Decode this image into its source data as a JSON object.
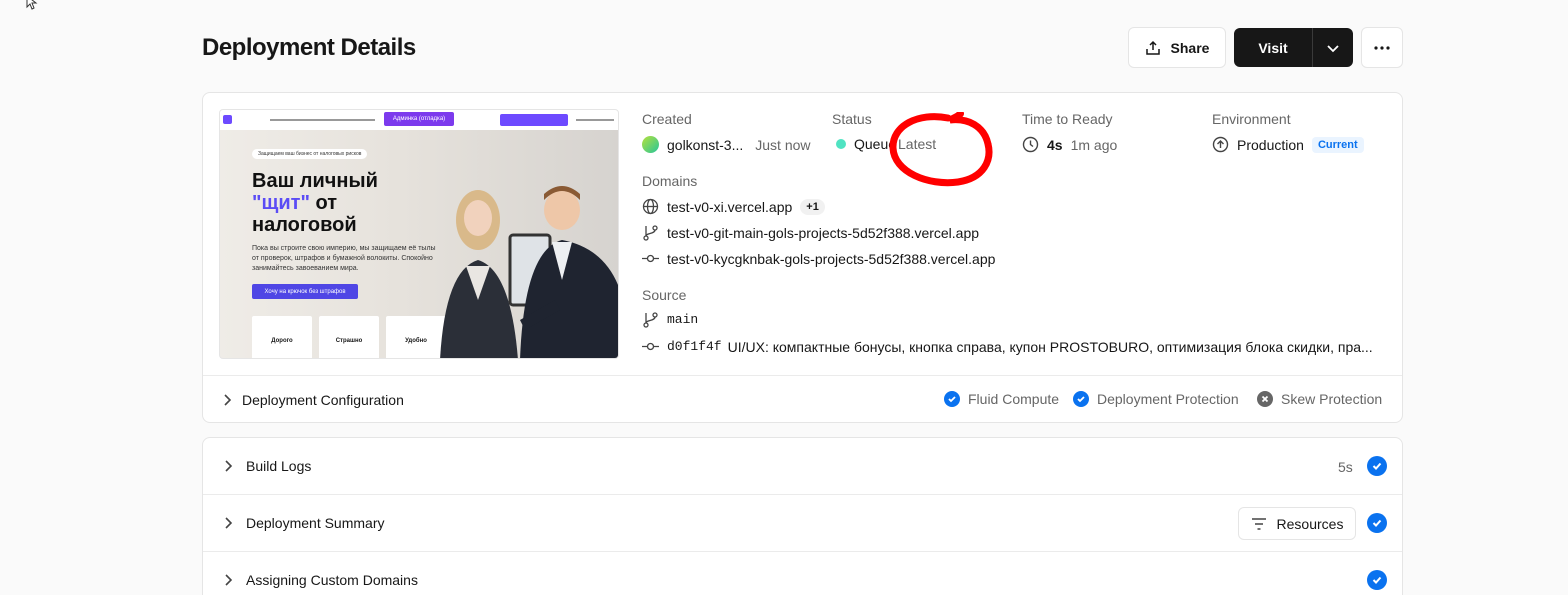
{
  "header": {
    "title": "Deployment Details",
    "share_label": "Share",
    "visit_label": "Visit"
  },
  "preview": {
    "nav_badge": "Админка (отладка)",
    "tagline": "Защищаем ваш бизнес от налоговых рисков",
    "headline_1": "Ваш личный",
    "headline_2": "\"щит\"",
    "headline_2b": " от",
    "headline_3": "налоговой",
    "body": "Пока вы строите свою империю, мы защищаем её тылы от проверок, штрафов и бумажной волокиты. Спокойно занимайтесь завоеванием мира.",
    "cta": "Хочу на крючок без штрафов",
    "tiles": [
      "Дорого",
      "Страшно",
      "Удобно"
    ]
  },
  "info": {
    "created_label": "Created",
    "created_user": "golkonst-3...",
    "created_time": "Just now",
    "status_label": "Status",
    "status_value": "Queued",
    "status_tag": "Latest",
    "ready_label": "Time to Ready",
    "ready_value": "4s",
    "ready_ago": "1m ago",
    "env_label": "Environment",
    "env_value": "Production",
    "env_badge": "Current",
    "domains_label": "Domains",
    "domains": [
      "test-v0-xi.vercel.app",
      "test-v0-git-main-gols-projects-5d52f388.vercel.app",
      "test-v0-kycgknbak-gols-projects-5d52f388.vercel.app"
    ],
    "domains_extra": "+1",
    "source_label": "Source",
    "branch": "main",
    "commit_hash": "d0f1f4f",
    "commit_message": "UI/UX: компактные бонусы, кнопка справа, купон PROSTOBURO, оптимизация блока скидки, пра..."
  },
  "config": {
    "label": "Deployment Configuration",
    "features": [
      {
        "label": "Fluid Compute",
        "enabled": true
      },
      {
        "label": "Deployment Protection",
        "enabled": true
      },
      {
        "label": "Skew Protection",
        "enabled": false
      }
    ]
  },
  "steps": [
    {
      "label": "Build Logs",
      "duration": "5s"
    },
    {
      "label": "Deployment Summary",
      "action": "Resources"
    },
    {
      "label": "Assigning Custom Domains"
    }
  ],
  "colors": {
    "accent": "#0a72ef",
    "status_dot": "#50e3c2",
    "annotation": "#ff0000"
  }
}
